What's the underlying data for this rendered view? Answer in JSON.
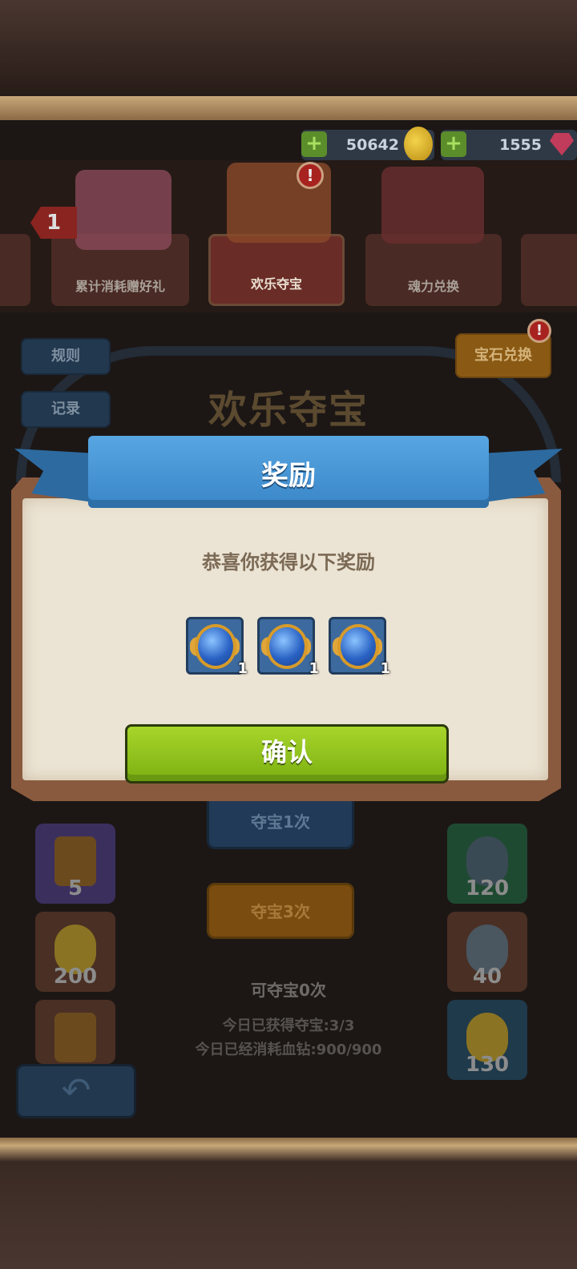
{
  "currency": {
    "gold": "50642",
    "gems": "1555",
    "gold_icon": "gold-coin-icon",
    "gem_icon": "red-gem-icon",
    "add_icon": "plus-icon"
  },
  "tabs": [
    {
      "label": "累计消耗赠好礼",
      "badge": "1"
    },
    {
      "label": "欢乐夺宝",
      "badge": "!"
    },
    {
      "label": "魂力兑换"
    }
  ],
  "page": {
    "title": "欢乐夺宝",
    "rules_label": "规则",
    "records_label": "记录",
    "gem_exchange_label": "宝石兑换",
    "gem_exchange_badge": "!",
    "draw_once_label": "夺宝1次",
    "draw_three_label": "夺宝3次",
    "draws_available": "可夺宝0次",
    "today_obtained": "今日已获得夺宝:3/3",
    "today_consumed": "今日已经消耗血钻:900/900",
    "left_slots": [
      "5",
      "200"
    ],
    "right_slots": [
      "120",
      "40",
      "130"
    ]
  },
  "modal": {
    "title": "奖励",
    "message": "恭喜你获得以下奖励",
    "rewards": [
      {
        "icon": "blue-winged-orb-icon",
        "qty": "1"
      },
      {
        "icon": "blue-winged-orb-icon",
        "qty": "1"
      },
      {
        "icon": "blue-winged-orb-icon",
        "qty": "1"
      }
    ],
    "confirm_label": "确认"
  },
  "colors": {
    "ribbon": "#3a86c8",
    "confirm": "#8cc01a",
    "parchment": "#ebe3d3",
    "frame": "#8a5a3e"
  }
}
